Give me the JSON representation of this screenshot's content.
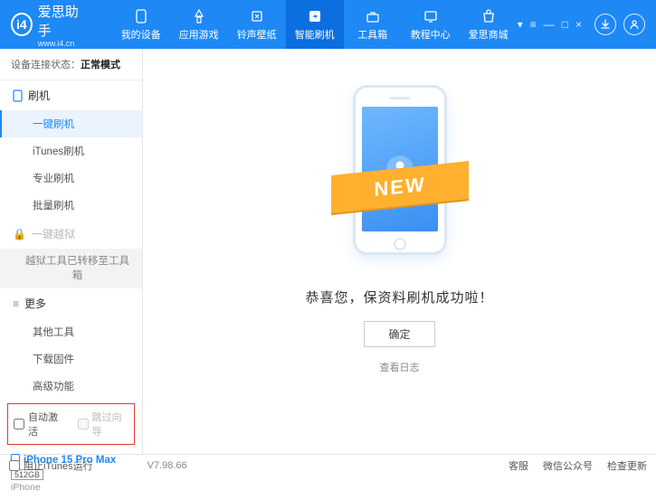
{
  "header": {
    "app_name": "爱思助手",
    "app_url": "www.i4.cn",
    "logo_letter": "i4"
  },
  "topnav": [
    {
      "label": "我的设备",
      "icon": "device-icon"
    },
    {
      "label": "应用游戏",
      "icon": "apps-icon"
    },
    {
      "label": "铃声壁纸",
      "icon": "ringtone-icon"
    },
    {
      "label": "智能刷机",
      "icon": "flash-icon",
      "active": true
    },
    {
      "label": "工具箱",
      "icon": "toolbox-icon"
    },
    {
      "label": "教程中心",
      "icon": "tutorial-icon"
    },
    {
      "label": "爱思商城",
      "icon": "shop-icon"
    }
  ],
  "sidebar": {
    "conn_label": "设备连接状态：",
    "conn_value": "正常模式",
    "sect_flash": "刷机",
    "items_flash": [
      "一键刷机",
      "iTunes刷机",
      "专业刷机",
      "批量刷机"
    ],
    "sect_jailbreak": "一键越狱",
    "jailbreak_note": "越狱工具已转移至工具箱",
    "sect_more": "更多",
    "items_more": [
      "其他工具",
      "下载固件",
      "高级功能"
    ],
    "auto_activate": "自动激活",
    "skip_wizard": "跳过向导"
  },
  "device": {
    "name": "iPhone 15 Pro Max",
    "storage": "512GB",
    "type": "iPhone"
  },
  "main": {
    "new_badge": "NEW",
    "success": "恭喜您，保资料刷机成功啦！",
    "ok": "确定",
    "view_log": "查看日志"
  },
  "footer": {
    "block_itunes": "阻止iTunes运行",
    "version": "V7.98.66",
    "links": [
      "客服",
      "微信公众号",
      "检查更新"
    ]
  }
}
